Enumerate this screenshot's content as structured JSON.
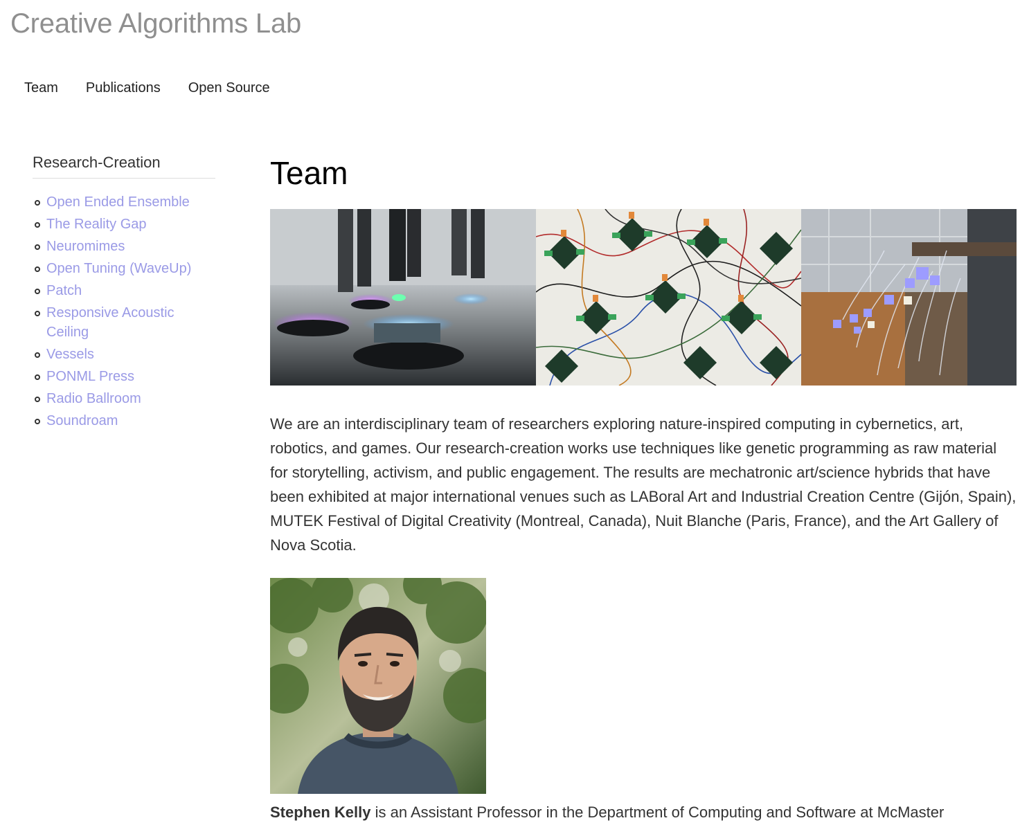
{
  "site": {
    "title": "Creative Algorithms Lab"
  },
  "nav": {
    "items": [
      {
        "label": "Team"
      },
      {
        "label": "Publications"
      },
      {
        "label": "Open Source"
      }
    ]
  },
  "sidebar": {
    "heading": "Research-Creation",
    "items": [
      {
        "label": "Open Ended Ensemble"
      },
      {
        "label": "The Reality Gap"
      },
      {
        "label": "Neuromimes"
      },
      {
        "label": "Open Tuning (WaveUp)"
      },
      {
        "label": "Patch"
      },
      {
        "label": "Responsive Acoustic Ceiling"
      },
      {
        "label": "Vessels"
      },
      {
        "label": "PONML Press"
      },
      {
        "label": "Radio Ballroom"
      },
      {
        "label": "Soundroam"
      }
    ]
  },
  "main": {
    "title": "Team",
    "intro": "We are an interdisciplinary team of researchers exploring nature-inspired computing in cybernetics, art, robotics, and games. Our research-creation works use techniques like genetic programming as raw material for storytelling, activism, and public engagement. The results are mechatronic art/science hybrids that have been exhibited at major international venues such as LABoral Art and Industrial Creation Centre (Gijón, Spain), MUTEK Festival of Digital Creativity (Montreal, Canada), Nuit Blanche (Paris, France), and the Art Gallery of Nova Scotia.",
    "bio": {
      "name": "Stephen Kelly",
      "text": " is an Assistant Professor in the Department of Computing and Software at McMaster"
    }
  }
}
